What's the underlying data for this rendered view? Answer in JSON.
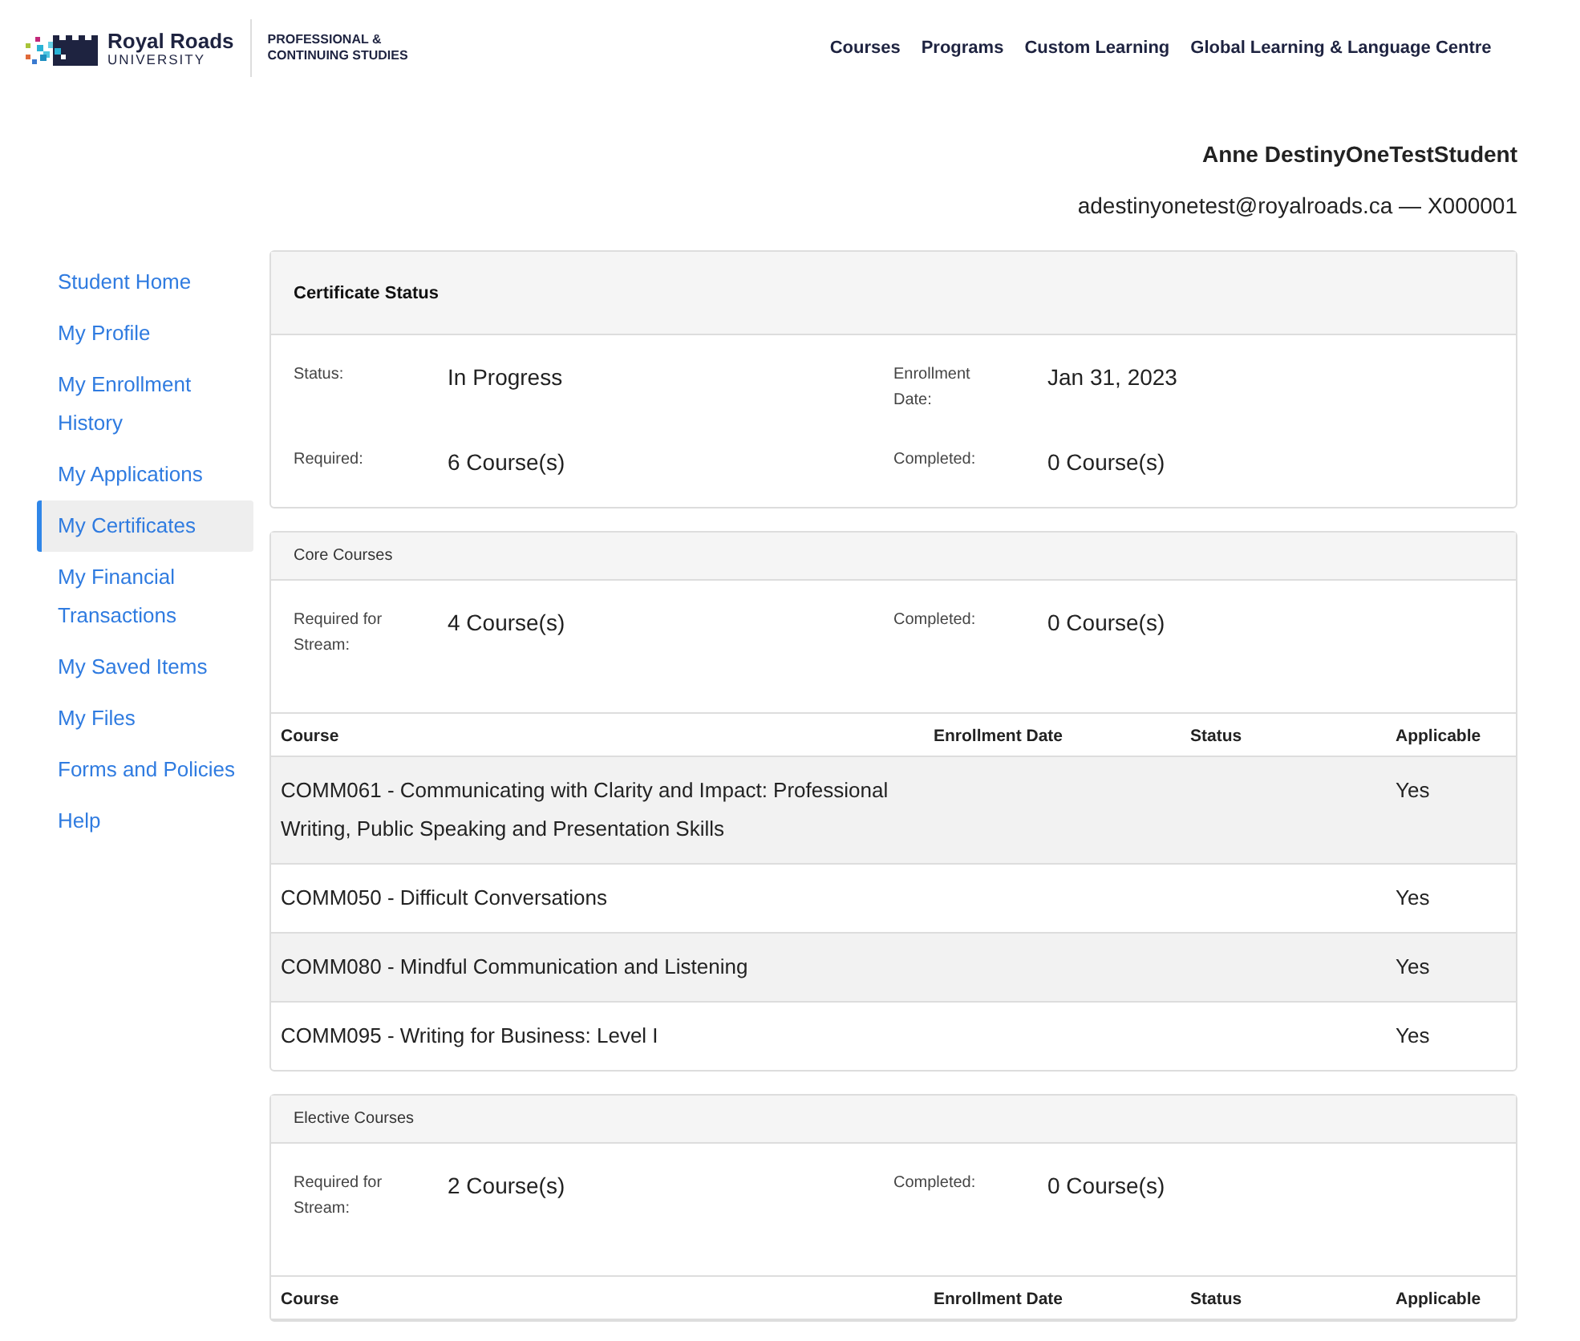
{
  "header": {
    "logo": {
      "name": "Royal Roads",
      "subtitle": "UNIVERSITY"
    },
    "division": [
      "PROFESSIONAL &",
      "CONTINUING STUDIES"
    ],
    "nav": [
      "Courses",
      "Programs",
      "Custom Learning",
      "Global Learning & Language Centre"
    ]
  },
  "user": {
    "name": "Anne DestinyOneTestStudent",
    "email_id": "adestinyonetest@royalroads.ca — X000001"
  },
  "sidebar": {
    "items": [
      {
        "label": "Student Home",
        "selected": false
      },
      {
        "label": "My Profile",
        "selected": false
      },
      {
        "label": "My Enrollment History",
        "selected": false
      },
      {
        "label": "My Applications",
        "selected": false
      },
      {
        "label": "My Certificates",
        "selected": true
      },
      {
        "label": "My Financial Transactions",
        "selected": false
      },
      {
        "label": "My Saved Items",
        "selected": false
      },
      {
        "label": "My Files",
        "selected": false
      },
      {
        "label": "Forms and Policies",
        "selected": false
      },
      {
        "label": "Help",
        "selected": false
      }
    ]
  },
  "sections": [
    {
      "kind": "summary",
      "title": "Certificate Status",
      "fields": [
        {
          "label": "Status:",
          "value": "In Progress"
        },
        {
          "label": "Enrollment Date:",
          "value": "Jan 31, 2023"
        },
        {
          "label": "Required:",
          "value": "6 Course(s)"
        },
        {
          "label": "Completed:",
          "value": "0 Course(s)"
        }
      ]
    },
    {
      "kind": "courses",
      "title": "Core Courses",
      "fields": [
        {
          "label": "Required for Stream:",
          "value": "4 Course(s)"
        },
        {
          "label": "Completed:",
          "value": "0 Course(s)"
        }
      ],
      "table": {
        "columns": [
          "Course",
          "Enrollment Date",
          "Status",
          "Applicable"
        ],
        "rows": [
          {
            "course": "COMM061 - Communicating with Clarity and Impact: Professional Writing, Public Speaking and Presentation Skills",
            "applicable": "Yes"
          },
          {
            "course": "COMM050 - Difficult Conversations",
            "applicable": "Yes"
          },
          {
            "course": "COMM080 - Mindful Communication and Listening",
            "applicable": "Yes"
          },
          {
            "course": "COMM095 - Writing for Business: Level I",
            "applicable": "Yes"
          }
        ]
      }
    },
    {
      "kind": "courses",
      "title": "Elective Courses",
      "fields": [
        {
          "label": "Required for Stream:",
          "value": "2 Course(s)"
        },
        {
          "label": "Completed:",
          "value": "0 Course(s)"
        }
      ],
      "table": {
        "columns": [
          "Course",
          "Enrollment Date",
          "Status",
          "Applicable"
        ]
      }
    }
  ]
}
